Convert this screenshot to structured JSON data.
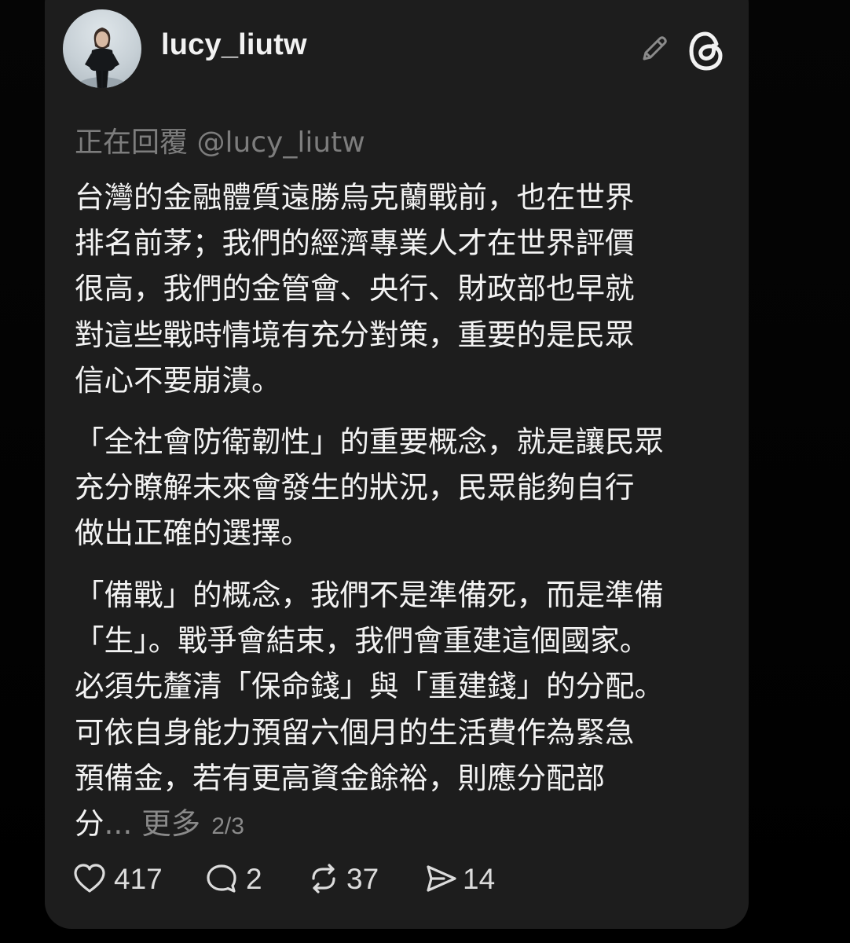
{
  "post": {
    "username": "lucy_liutw",
    "reply_to": "正在回覆 @lucy_liutw",
    "paragraphs": [
      {
        "lines": [
          "台灣的金融體質遠勝烏克蘭戰前，也在世界",
          "排名前茅；我們的經濟專業人才在世界評價",
          "很高，我們的金管會、央行、財政部也早就",
          "對這些戰時情境有充分對策，重要的是民眾",
          "信心不要崩潰。"
        ]
      },
      {
        "lines": [
          "「全社會防衛韌性」的重要概念，就是讓民眾",
          "充分瞭解未來會發生的狀況，民眾能夠自行",
          "做出正確的選擇。"
        ]
      },
      {
        "lines": [
          "「備戰」的概念，我們不是準備死，而是準備",
          "「生」。戰爭會結束，我們會重建這個國家。",
          "必須先釐清「保命錢」與「重建錢」的分配。",
          "可依自身能力預留六個月的生活費作為緊急",
          "預備金，若有更高資金餘裕，則應分配部"
        ],
        "last_fragment": "分",
        "ellipsis": "...",
        "more_label": "更多",
        "page_indicator": "2/3"
      }
    ],
    "actions": {
      "like": {
        "icon": "heart-icon",
        "count": "417"
      },
      "reply": {
        "icon": "reply-bubble-icon",
        "count": "2"
      },
      "repost": {
        "icon": "repost-icon",
        "count": "37"
      },
      "share": {
        "icon": "send-icon",
        "count": "14"
      }
    }
  },
  "header_icons": [
    "edit-pencil-icon",
    "threads-logo-icon"
  ],
  "colors": {
    "background": "#000000",
    "card": "#1d1d1d",
    "text": "#f3f3f3",
    "muted": "#7d7d7d"
  }
}
